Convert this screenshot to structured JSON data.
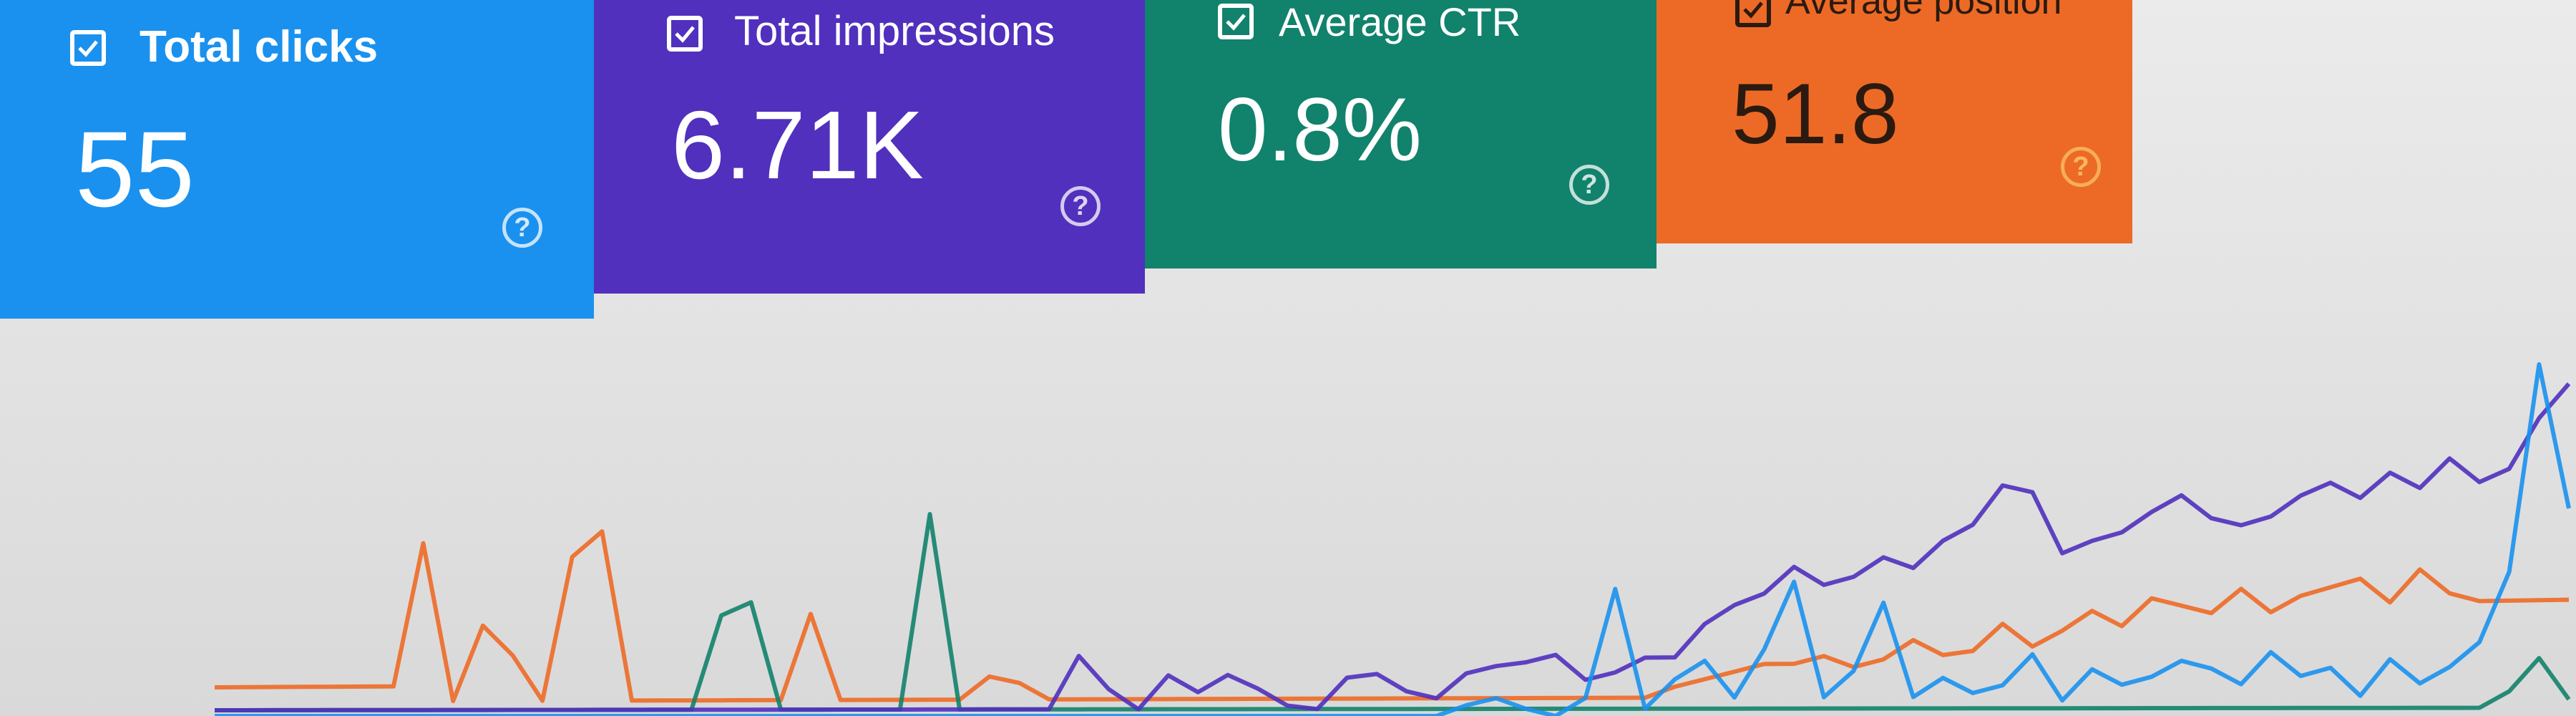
{
  "cards": {
    "clicks": {
      "label": "Total clicks",
      "value": "55",
      "color": "#1a91ee",
      "checked": true,
      "help_icon": "help-circle-icon"
    },
    "impressions": {
      "label": "Total impressions",
      "value": "6.71K",
      "color": "#5030bd",
      "checked": true,
      "help_icon": "help-circle-icon"
    },
    "ctr": {
      "label": "Average CTR",
      "value": "0.8%",
      "color": "#11826b",
      "checked": true,
      "help_icon": "help-circle-icon"
    },
    "position": {
      "label": "Average position",
      "value": "51.8",
      "color": "#ed6a26",
      "checked": true,
      "help_icon": "help-circle-icon"
    }
  },
  "chart_data": {
    "type": "line",
    "x": [
      0,
      1,
      2,
      3,
      4,
      5,
      6,
      7,
      8,
      9,
      10,
      11,
      12,
      13,
      14,
      15,
      16,
      17,
      18,
      19,
      20,
      21,
      22,
      23,
      24,
      25,
      26,
      27,
      28,
      29,
      30,
      31,
      32,
      33,
      34,
      35,
      36,
      37,
      38,
      39,
      40,
      41,
      42,
      43,
      44,
      45,
      46,
      47,
      48,
      49,
      50,
      51,
      52,
      53,
      54,
      55,
      56,
      57,
      58,
      59,
      60,
      61,
      62,
      63,
      64,
      65,
      66,
      67,
      68,
      69,
      70,
      71,
      72,
      73,
      74,
      75,
      76,
      77,
      78,
      79
    ],
    "grid": false,
    "series": [
      {
        "color": "#ed6a26",
        "values": [
          0.1,
          0.1,
          0.1,
          0.1,
          0.1,
          0.1,
          0.1,
          0.58,
          0.05,
          0.3,
          0.2,
          0.05,
          0.52,
          0.6,
          0.05,
          0.05,
          0.05,
          0.05,
          0.05,
          0.05,
          0.32,
          0.05,
          0.05,
          0.05,
          0.05,
          0.05,
          0.12,
          0.1,
          0.05,
          0.05,
          0.05,
          0.05,
          0.05,
          0.05,
          0.05,
          0.05,
          0.05,
          0.05,
          0.05,
          0.05,
          0.05,
          0.05,
          0.05,
          0.05,
          0.05,
          0.05,
          0.05,
          0.05,
          0.05,
          0.08,
          0.1,
          0.12,
          0.14,
          0.14,
          0.16,
          0.13,
          0.15,
          0.2,
          0.16,
          0.17,
          0.24,
          0.18,
          0.22,
          0.27,
          0.23,
          0.3,
          0.28,
          0.26,
          0.32,
          0.26,
          0.3,
          0.32,
          0.34,
          0.28,
          0.36,
          0.3,
          0.28,
          0.28,
          0.28,
          0.28
        ]
      },
      {
        "color": "#11826b",
        "values": [
          0.02,
          0.02,
          0.02,
          0.02,
          0.02,
          0.02,
          0.02,
          0.02,
          0.02,
          0.02,
          0.02,
          0.02,
          0.02,
          0.02,
          0.02,
          0.02,
          0.02,
          0.32,
          0.36,
          0.02,
          0.02,
          0.02,
          0.02,
          0.02,
          0.62,
          0.02,
          0.02,
          0.02,
          0.02,
          0.02,
          0.02,
          0.02,
          0.02,
          0.02,
          0.02,
          0.02,
          0.02,
          0.02,
          0.02,
          0.02,
          0.02,
          0.02,
          0.02,
          0.02,
          0.02,
          0.02,
          0.02,
          0.02,
          0.02,
          0.02,
          0.02,
          0.02,
          0.02,
          0.02,
          0.02,
          0.02,
          0.02,
          0.02,
          0.02,
          0.02,
          0.02,
          0.02,
          0.02,
          0.02,
          0.02,
          0.02,
          0.02,
          0.02,
          0.02,
          0.02,
          0.02,
          0.02,
          0.02,
          0.02,
          0.02,
          0.02,
          0.02,
          0.06,
          0.14,
          0.04
        ]
      },
      {
        "color": "#5030bd",
        "values": [
          0.02,
          0.02,
          0.02,
          0.02,
          0.02,
          0.02,
          0.02,
          0.02,
          0.02,
          0.02,
          0.02,
          0.02,
          0.02,
          0.02,
          0.02,
          0.02,
          0.02,
          0.02,
          0.02,
          0.02,
          0.02,
          0.02,
          0.02,
          0.02,
          0.02,
          0.02,
          0.02,
          0.02,
          0.02,
          0.18,
          0.08,
          0.02,
          0.12,
          0.07,
          0.12,
          0.08,
          0.03,
          0.02,
          0.11,
          0.12,
          0.07,
          0.05,
          0.12,
          0.14,
          0.15,
          0.17,
          0.1,
          0.12,
          0.16,
          0.16,
          0.25,
          0.3,
          0.33,
          0.4,
          0.35,
          0.37,
          0.42,
          0.39,
          0.46,
          0.5,
          0.6,
          0.58,
          0.42,
          0.45,
          0.47,
          0.52,
          0.56,
          0.5,
          0.48,
          0.5,
          0.55,
          0.58,
          0.54,
          0.6,
          0.56,
          0.63,
          0.57,
          0.6,
          0.72,
          0.8
        ]
      },
      {
        "color": "#1a91ee",
        "values": [
          0,
          0,
          0,
          0,
          0,
          0,
          0,
          0,
          0,
          0,
          0,
          0,
          0,
          0,
          0,
          0,
          0,
          0,
          0,
          0,
          0,
          0,
          0,
          0,
          0,
          0,
          0,
          0,
          0,
          0,
          0,
          0,
          0,
          0,
          0,
          0,
          0,
          0,
          0,
          0,
          0,
          0,
          0.03,
          0.05,
          0.02,
          0,
          0.05,
          0.35,
          0.02,
          0.1,
          0.15,
          0.05,
          0.18,
          0.36,
          0.05,
          0.12,
          0.3,
          0.05,
          0.1,
          0.06,
          0.08,
          0.16,
          0.04,
          0.12,
          0.08,
          0.1,
          0.14,
          0.12,
          0.08,
          0.16,
          0.1,
          0.12,
          0.05,
          0.14,
          0.08,
          0.12,
          0.18,
          0.35,
          0.85,
          0.5
        ]
      }
    ]
  }
}
